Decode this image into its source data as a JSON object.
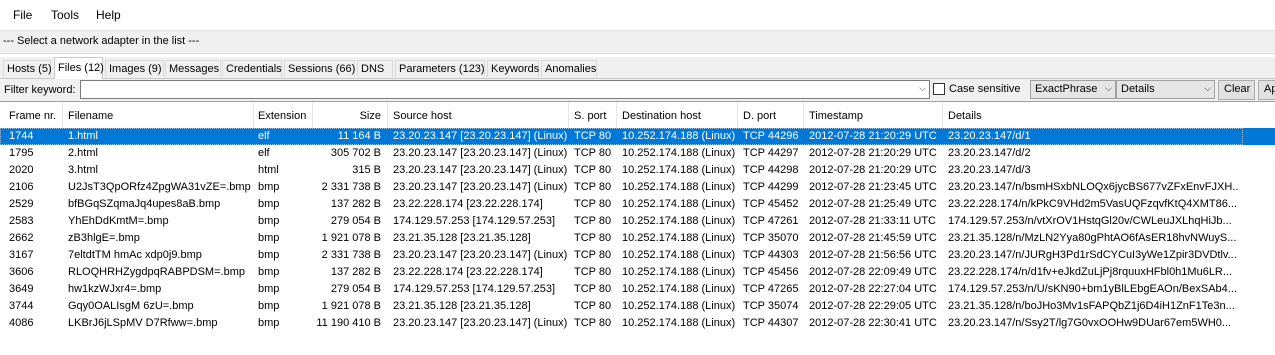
{
  "menu": [
    "File",
    "Tools",
    "Help"
  ],
  "adapter_text": "--- Select a network adapter in the list ---",
  "tabs": [
    {
      "label": "Hosts (5)",
      "active": false
    },
    {
      "label": "Files (12)",
      "active": true
    },
    {
      "label": "Images (9)",
      "active": false
    },
    {
      "label": "Messages",
      "active": false
    },
    {
      "label": "Credentials",
      "active": false
    },
    {
      "label": "Sessions (66)",
      "active": false
    },
    {
      "label": "DNS",
      "active": false
    },
    {
      "label": "Parameters (123)",
      "active": false
    },
    {
      "label": "Keywords",
      "active": false
    },
    {
      "label": "Anomalies",
      "active": false
    }
  ],
  "filter": {
    "label": "Filter keyword:",
    "value": "",
    "case_sensitive_label": "Case sensitive",
    "case_sensitive": false,
    "match_mode": "ExactPhrase",
    "column": "Details",
    "clear_label": "Clear",
    "apply_label": "Ap"
  },
  "columns": [
    "Frame nr.",
    "Filename",
    "Extension",
    "Size",
    "Source host",
    "S. port",
    "Destination host",
    "D. port",
    "Timestamp",
    "Details"
  ],
  "rows": [
    {
      "frame": "1744",
      "file": "1.html",
      "ext": "elf",
      "size": "11 164 B",
      "src": "23.20.23.147 [23.20.23.147] (Linux)",
      "sport": "TCP 80",
      "dst": "10.252.174.188 (Linux)",
      "dport": "TCP 44296",
      "ts": "2012-07-28 21:20:29 UTC",
      "details": "23.20.23.147/d/1",
      "selected": true
    },
    {
      "frame": "1795",
      "file": "2.html",
      "ext": "elf",
      "size": "305 702 B",
      "src": "23.20.23.147 [23.20.23.147] (Linux)",
      "sport": "TCP 80",
      "dst": "10.252.174.188 (Linux)",
      "dport": "TCP 44297",
      "ts": "2012-07-28 21:20:29 UTC",
      "details": "23.20.23.147/d/2",
      "selected": false
    },
    {
      "frame": "2020",
      "file": "3.html",
      "ext": "html",
      "size": "315 B",
      "src": "23.20.23.147 [23.20.23.147] (Linux)",
      "sport": "TCP 80",
      "dst": "10.252.174.188 (Linux)",
      "dport": "TCP 44298",
      "ts": "2012-07-28 21:20:29 UTC",
      "details": "23.20.23.147/d/3",
      "selected": false
    },
    {
      "frame": "2106",
      "file": "U2JsT3QpORfz4ZpgWA31vZE=.bmp",
      "ext": "bmp",
      "size": "2 331 738 B",
      "src": "23.20.23.147 [23.20.23.147] (Linux)",
      "sport": "TCP 80",
      "dst": "10.252.174.188 (Linux)",
      "dport": "TCP 44299",
      "ts": "2012-07-28 21:23:45 UTC",
      "details": "23.20.23.147/n/bsmHSxbNLOQx6jycBS677vZFxEnvFJXH...",
      "selected": false
    },
    {
      "frame": "2529",
      "file": "bfBGqSZqmaJq4upes8aB.bmp",
      "ext": "bmp",
      "size": "137 282 B",
      "src": "23.22.228.174 [23.22.228.174]",
      "sport": "TCP 80",
      "dst": "10.252.174.188 (Linux)",
      "dport": "TCP 45452",
      "ts": "2012-07-28 21:25:49 UTC",
      "details": "23.22.228.174/n/kPkC9VHd2m5VasUQFzqvfKtQ4XMT86...",
      "selected": false
    },
    {
      "frame": "2583",
      "file": "YhEhDdKmtM=.bmp",
      "ext": "bmp",
      "size": "279 054 B",
      "src": "174.129.57.253 [174.129.57.253]",
      "sport": "TCP 80",
      "dst": "10.252.174.188 (Linux)",
      "dport": "TCP 47261",
      "ts": "2012-07-28 21:33:11 UTC",
      "details": "174.129.57.253/n/vtXrOV1HstqGl20v/CWLeuJXLhqHiJb...",
      "selected": false
    },
    {
      "frame": "2662",
      "file": "zB3hlgE=.bmp",
      "ext": "bmp",
      "size": "1 921 078 B",
      "src": "23.21.35.128 [23.21.35.128]",
      "sport": "TCP 80",
      "dst": "10.252.174.188 (Linux)",
      "dport": "TCP 35070",
      "ts": "2012-07-28 21:45:59 UTC",
      "details": "23.21.35.128/n/MzLN2Yya80gPhtAO6fAsER18hvNWuyS...",
      "selected": false
    },
    {
      "frame": "3167",
      "file": "7eltdtTM hmAc xdp0j9.bmp",
      "ext": "bmp",
      "size": "2 331 738 B",
      "src": "23.20.23.147 [23.20.23.147] (Linux)",
      "sport": "TCP 80",
      "dst": "10.252.174.188 (Linux)",
      "dport": "TCP 44303",
      "ts": "2012-07-28 21:56:56 UTC",
      "details": "23.20.23.147/n/JURgH3Pd1rSdCYCuI3yWe1Zpir3DVDtlv...",
      "selected": false
    },
    {
      "frame": "3606",
      "file": "RLOQHRHZygdpqRABPDSM=.bmp",
      "ext": "bmp",
      "size": "137 282 B",
      "src": "23.22.228.174 [23.22.228.174]",
      "sport": "TCP 80",
      "dst": "10.252.174.188 (Linux)",
      "dport": "TCP 45456",
      "ts": "2012-07-28 22:09:49 UTC",
      "details": "23.22.228.174/n/d1fv+eJkdZuLjPj8rquuxHFbl0h1Mu6LR...",
      "selected": false
    },
    {
      "frame": "3649",
      "file": " hw1kzWJxr4=.bmp",
      "ext": "bmp",
      "size": "279 054 B",
      "src": "174.129.57.253 [174.129.57.253]",
      "sport": "TCP 80",
      "dst": "10.252.174.188 (Linux)",
      "dport": "TCP 47265",
      "ts": "2012-07-28 22:27:04 UTC",
      "details": "174.129.57.253/n/U/sKN90+bm1yBlLEbgEAOn/BexSAb4...",
      "selected": false
    },
    {
      "frame": "3744",
      "file": "Gqy0OALIsgM 6zU=.bmp",
      "ext": "bmp",
      "size": "1 921 078 B",
      "src": "23.21.35.128 [23.21.35.128]",
      "sport": "TCP 80",
      "dst": "10.252.174.188 (Linux)",
      "dport": "TCP 35074",
      "ts": "2012-07-28 22:29:05 UTC",
      "details": "23.21.35.128/n/boJHo3Mv1sFAPQbZ1j6D4iH1ZnF1Te3n...",
      "selected": false
    },
    {
      "frame": "4086",
      "file": "LKBrJ6jLSpMV D7Rfww=.bmp",
      "ext": "bmp",
      "size": "11 190 410 B",
      "src": "23.20.23.147 [23.20.23.147] (Linux)",
      "sport": "TCP 80",
      "dst": "10.252.174.188 (Linux)",
      "dport": "TCP 44307",
      "ts": "2012-07-28 22:30:41 UTC",
      "details": "23.20.23.147/n/Ssy2T/lg7G0vxOOHw9DUar67em5WH0...",
      "selected": false
    }
  ]
}
